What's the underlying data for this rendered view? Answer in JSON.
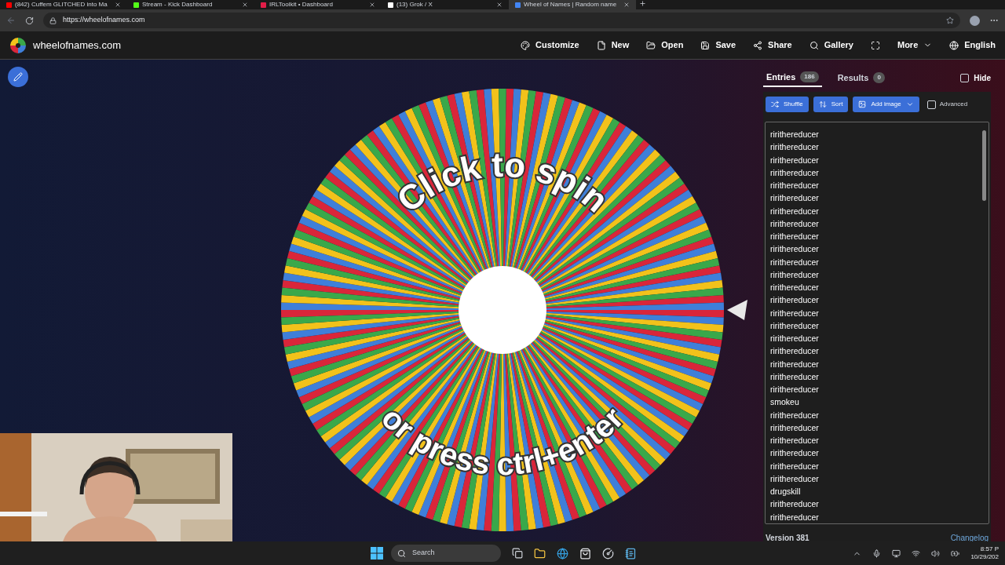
{
  "browser": {
    "tabs": [
      {
        "title": "(842) Cuffem GLITCHED into Ma",
        "color": "#ff0000",
        "selected": false
      },
      {
        "title": "Stream - Kick Dashboard",
        "color": "#53fc18",
        "selected": false
      },
      {
        "title": "IRLToolkit • Dashboard",
        "color": "#e11d48",
        "selected": false
      },
      {
        "title": "(13) Grok / X",
        "color": "#ffffff",
        "selected": false
      },
      {
        "title": "Wheel of Names | Random name",
        "color": "#4285f4",
        "selected": true
      }
    ],
    "url": "https://wheelofnames.com"
  },
  "site": {
    "logo_text": "wheelofnames.com",
    "menu": [
      {
        "label": "Customize",
        "dropdown": false
      },
      {
        "label": "New",
        "dropdown": false
      },
      {
        "label": "Open",
        "dropdown": false
      },
      {
        "label": "Save",
        "dropdown": false
      },
      {
        "label": "Share",
        "dropdown": false
      },
      {
        "label": "Gallery",
        "dropdown": false
      },
      {
        "label": "More",
        "dropdown": true
      },
      {
        "label": "English",
        "dropdown": false
      }
    ]
  },
  "wheel": {
    "prompt": "Click to spin",
    "hint": "or press ctrl+enter"
  },
  "panel": {
    "tabs": [
      {
        "label": "Entries",
        "count": "186",
        "selected": true
      },
      {
        "label": "Results",
        "count": "0",
        "selected": false
      }
    ],
    "hide": {
      "label": "Hide",
      "checked": false
    },
    "buttons": [
      {
        "label": "Shuffle",
        "dropdown": false
      },
      {
        "label": "Sort",
        "dropdown": false
      },
      {
        "label": "Add image",
        "dropdown": true
      }
    ],
    "advanced": {
      "label": "Advanced",
      "checked": false
    },
    "entries": [
      "ririthereducer",
      "ririthereducer",
      "ririthereducer",
      "ririthereducer",
      "ririthereducer",
      "ririthereducer",
      "ririthereducer",
      "ririthereducer",
      "ririthereducer",
      "ririthereducer",
      "ririthereducer",
      "ririthereducer",
      "ririthereducer",
      "ririthereducer",
      "ririthereducer",
      "ririthereducer",
      "ririthereducer",
      "ririthereducer",
      "ririthereducer",
      "ririthereducer",
      "ririthereducer",
      "smokeu",
      "ririthereducer",
      "ririthereducer",
      "ririthereducer",
      "ririthereducer",
      "ririthereducer",
      "ririthereducer",
      "drugskill",
      "ririthereducer",
      "ririthereducer"
    ],
    "version": "Version 381",
    "changelog": "Changelog"
  },
  "taskbar": {
    "search_placeholder": "Search",
    "time": "8:57 P",
    "date": "10/29/202"
  }
}
